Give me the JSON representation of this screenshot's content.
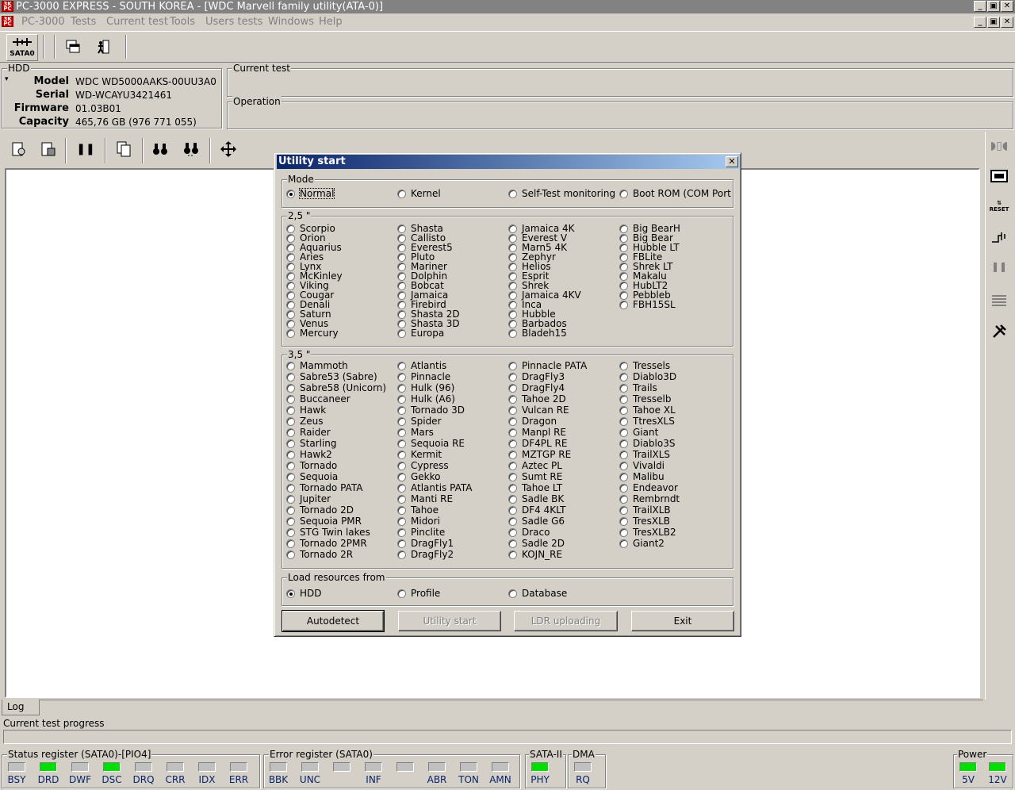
{
  "window": {
    "title": "PC-3000 EXPRESS - SOUTH KOREA - [WDC Marvell family utility(ATA-0)]"
  },
  "menu": [
    "PC-3000",
    "Tests",
    "Current test",
    "Tools",
    "Users tests",
    "Windows",
    "Help"
  ],
  "toolbar": {
    "sata_label": "SATA0"
  },
  "hdd": {
    "group_label": "HDD",
    "model_label": "Model",
    "model": "WDC WD5000AAKS-00UU3A0",
    "serial_label": "Serial",
    "serial": "WD-WCAYU3421461",
    "firmware_label": "Firmware",
    "firmware": "01.03B01",
    "capacity_label": "Capacity",
    "capacity": "465,76 GB (976 771 055)"
  },
  "current_test": {
    "label": "Current test",
    "operation_label": "Operation"
  },
  "dialog": {
    "title": "Utility start",
    "mode_label": "Mode",
    "modes": [
      "Normal",
      "Kernel",
      "Self-Test monitoring",
      "Boot ROM (COM Port"
    ],
    "g25_label": "2,5 \"",
    "g25_cols": [
      [
        "Scorpio",
        "Orion",
        "Aquarius",
        "Aries",
        "Lynx",
        "McKinley",
        "Viking",
        "Cougar",
        "Denali",
        "Saturn",
        "Venus",
        "Mercury"
      ],
      [
        "Shasta",
        "Callisto",
        "Everest5",
        "Pluto",
        "Mariner",
        "Dolphin",
        "Bobcat",
        "Jamaica",
        "Firebird",
        "Shasta 2D",
        "Shasta 3D",
        "Europa"
      ],
      [
        "Jamaica 4K",
        "Everest V",
        "Marn5 4K",
        "Zephyr",
        "Helios",
        "Esprit",
        "Shrek",
        "Jamaica 4KV",
        "Inca",
        "Hubble",
        "Barbados",
        "Bladeh15"
      ],
      [
        "Big BearH",
        "Big Bear",
        "Hubble LT",
        "FBLite",
        "Shrek LT",
        "Makalu",
        "HubLT2",
        "Pebbleb",
        "FBH15SL"
      ]
    ],
    "g35_label": "3,5 \"",
    "g35_cols": [
      [
        "Mammoth",
        "Sabre53 (Sabre)",
        "Sabre58 (Unicorn)",
        "Buccaneer",
        "Hawk",
        "Zeus",
        "Raider",
        "Starling",
        "Hawk2",
        "Tornado",
        "Sequoia",
        "Tornado PATA",
        "Jupiter",
        "Tornado 2D",
        "Sequoia PMR",
        "STG Twin lakes",
        "Tornado 2PMR",
        "Tornado 2R"
      ],
      [
        "Atlantis",
        "Pinnacle",
        "Hulk (96)",
        "Hulk (A6)",
        "Tornado 3D",
        "Spider",
        "Mars",
        "Sequoia RE",
        "Kermit",
        "Cypress",
        "Gekko",
        "Atlantis PATA",
        "Manti RE",
        "Tahoe",
        "Midori",
        "Pinclite",
        "DragFly1",
        "DragFly2"
      ],
      [
        "Pinnacle PATA",
        "DragFly3",
        "DragFly4",
        "Tahoe 2D",
        "Vulcan RE",
        "Dragon",
        "Manpl RE",
        "DF4PL RE",
        "MZTGP RE",
        "Aztec PL",
        "Sumt RE",
        "Tahoe LT",
        "Sadle BK",
        "DF4 4KLT",
        "Sadle G6",
        "Draco",
        "Sadle 2D",
        "KOJN_RE"
      ],
      [
        "Tressels",
        "Diablo3D",
        "Trails",
        "Tresselb",
        "Tahoe XL",
        "TtresXLS",
        "Giant",
        "Diablo3S",
        "TrailXLS",
        "Vivaldi",
        "Malibu",
        "Endeavor",
        "Rembrndt",
        "TrailXLB",
        "TresXLB",
        "TresXLB2",
        "Giant2"
      ]
    ],
    "load_label": "Load resources from",
    "load": [
      "HDD",
      "Profile",
      "Database"
    ],
    "buttons": {
      "autodetect": "Autodetect",
      "utility_start": "Utility start",
      "ldr": "LDR uploading",
      "exit": "Exit"
    }
  },
  "log_tab": "Log",
  "progress_label": "Current test progress",
  "status": {
    "status_label": "Status register (SATA0)-[PIO4]",
    "status_leds": [
      [
        "BSY",
        false
      ],
      [
        "DRD",
        true
      ],
      [
        "DWF",
        false
      ],
      [
        "DSC",
        true
      ],
      [
        "DRQ",
        false
      ],
      [
        "CRR",
        false
      ],
      [
        "IDX",
        false
      ],
      [
        "ERR",
        false
      ]
    ],
    "error_label": "Error register (SATA0)",
    "error_leds": [
      [
        "BBK",
        false
      ],
      [
        "UNC",
        false
      ],
      [
        "",
        false
      ],
      [
        "INF",
        false
      ],
      [
        "",
        false
      ],
      [
        "ABR",
        false
      ],
      [
        "TON",
        false
      ],
      [
        "AMN",
        false
      ]
    ],
    "sata_label": "SATA-II",
    "sata_leds": [
      [
        "PHY",
        true
      ]
    ],
    "dma_label": "DMA",
    "dma_leds": [
      [
        "RQ",
        false
      ]
    ],
    "power_label": "Power",
    "power_leds": [
      [
        "5V",
        true
      ],
      [
        "12V",
        true
      ]
    ]
  }
}
